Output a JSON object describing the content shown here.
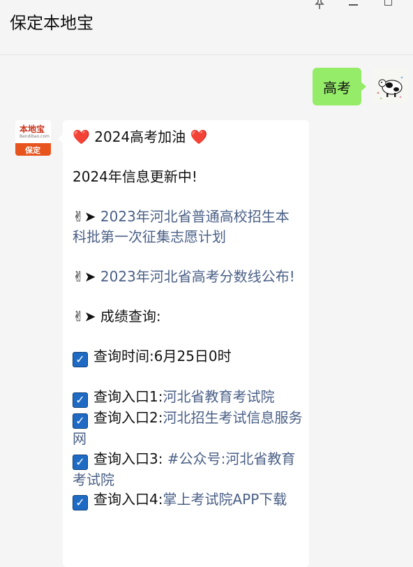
{
  "window": {
    "title": "保定本地宝"
  },
  "chat": {
    "my_message": "高考",
    "their_avatar": {
      "brand_text": "本地宝",
      "sub_text": "Bendibao.com",
      "badge_text": "保定"
    },
    "reply": {
      "line1_heart_left": "❤️",
      "line1_text": "2024高考加油",
      "line1_heart_right": "❤️",
      "line2": "2024年信息更新中!",
      "hand_icon": "✌",
      "arrow_icon": "➤",
      "link1": "2023年河北省普通高校招生本科批第一次征集志愿计划",
      "link2": "2023年河北省高考分数线公布!",
      "score_query_label": "成绩查询:",
      "check_glyph": "✓",
      "query_time_label": "查询时间:",
      "query_time_value": "6月25日0时",
      "entry1_label": "查询入口1:",
      "entry1_link": "河北省教育考试院",
      "entry2_label": "查询入口2:",
      "entry2_link": "河北招生考试信息服务网",
      "entry3_label": "查询入口3:",
      "entry3_link": "#公众号:河北省教育考试院",
      "entry4_label": "查询入口4:",
      "entry4_link": "掌上考试院APP下载"
    }
  },
  "colors": {
    "my_bubble": "#95ec69",
    "their_bubble": "#ffffff",
    "background": "#f5f5f5",
    "link": "#4a5f86",
    "checkbox": "#1f6bc4",
    "brand_orange": "#e8541d"
  }
}
